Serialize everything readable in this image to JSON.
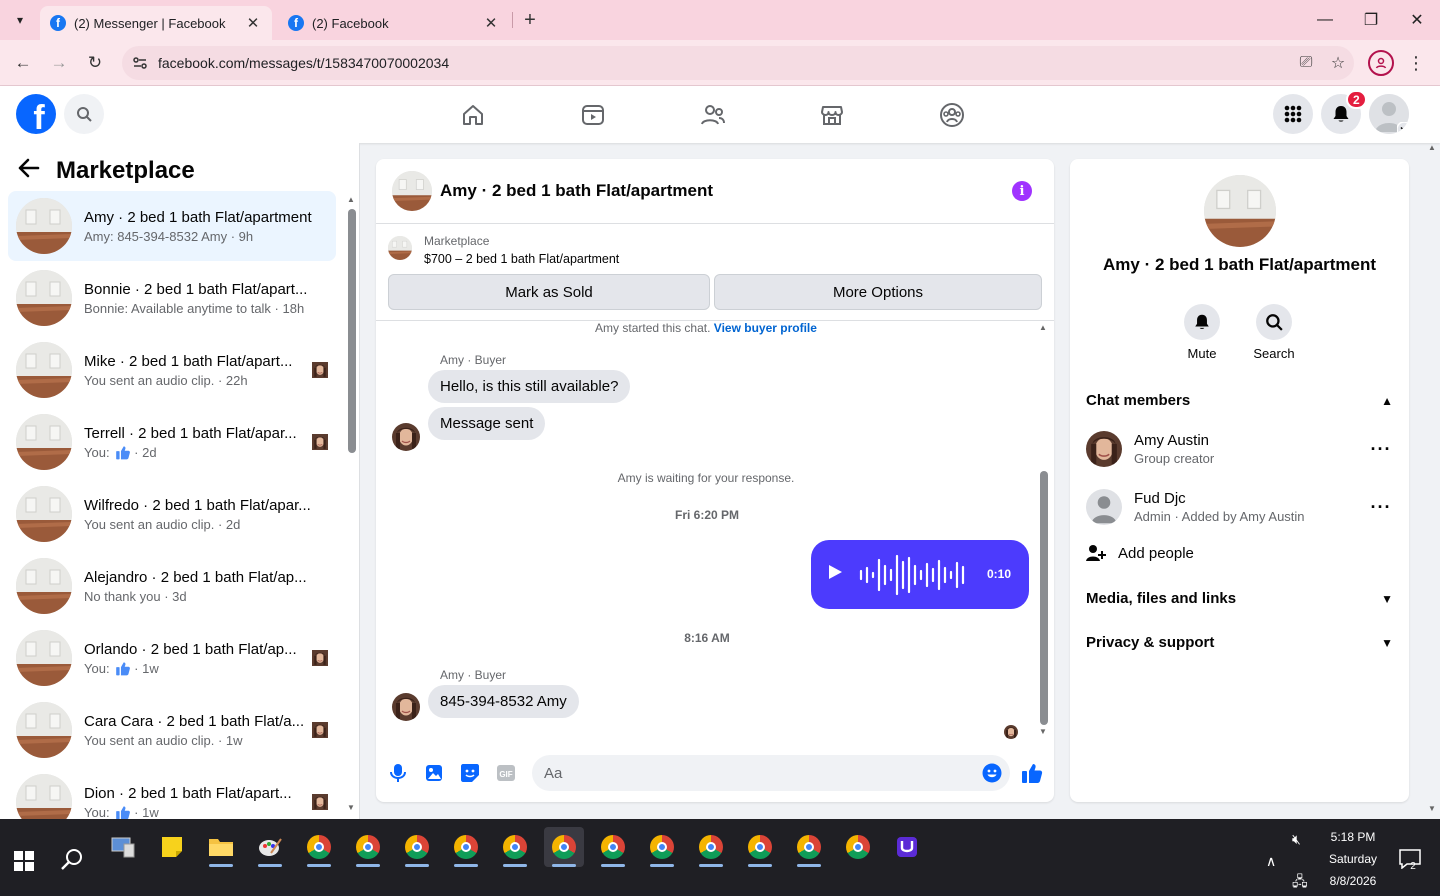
{
  "browser": {
    "tabs": [
      {
        "title": "(2) Messenger | Facebook",
        "active": true
      },
      {
        "title": "(2) Facebook",
        "active": false
      }
    ],
    "url": "facebook.com/messages/t/1583470070002034"
  },
  "header": {
    "notification_count": "2"
  },
  "left": {
    "title": "Marketplace",
    "conversations": [
      {
        "name": "Amy · 2 bed 1 bath Flat/apartment",
        "preview": "Amy: 845-394-8532 Amy",
        "time": "9h",
        "like": false,
        "mini": false,
        "selected": true
      },
      {
        "name": "Bonnie · 2 bed 1 bath Flat/apart...",
        "preview": "Bonnie: Available anytime to talk",
        "time": "18h",
        "like": false,
        "mini": false,
        "selected": false
      },
      {
        "name": "Mike · 2 bed 1 bath Flat/apart...",
        "preview": "You sent an audio clip.",
        "time": "22h",
        "like": false,
        "mini": true,
        "selected": false
      },
      {
        "name": "Terrell · 2 bed 1 bath Flat/apar...",
        "preview": "You:",
        "time": "2d",
        "like": true,
        "mini": true,
        "selected": false
      },
      {
        "name": "Wilfredo · 2 bed 1 bath Flat/apar...",
        "preview": "You sent an audio clip.",
        "time": "2d",
        "like": false,
        "mini": false,
        "selected": false
      },
      {
        "name": "Alejandro · 2 bed 1 bath Flat/ap...",
        "preview": "No thank you",
        "time": "3d",
        "like": false,
        "mini": false,
        "selected": false
      },
      {
        "name": "Orlando · 2 bed 1 bath Flat/ap...",
        "preview": "You:",
        "time": "1w",
        "like": true,
        "mini": true,
        "selected": false
      },
      {
        "name": "Cara Cara · 2 bed 1 bath Flat/a...",
        "preview": "You sent an audio clip.",
        "time": "1w",
        "like": false,
        "mini": true,
        "selected": false
      },
      {
        "name": "Dion · 2 bed 1 bath Flat/apart...",
        "preview": "You:",
        "time": "1w",
        "like": true,
        "mini": true,
        "selected": false
      }
    ]
  },
  "chat": {
    "title": "Amy · 2 bed 1 bath Flat/apartment",
    "marketplace_label": "Marketplace",
    "listing": "$700 – 2 bed 1 bath Flat/apartment",
    "mark_sold": "Mark as Sold",
    "more_options": "More Options",
    "started_text": "Amy started this chat.",
    "buyer_profile_link": "View buyer profile",
    "sender_label": "Amy · Buyer",
    "msg1": "Hello, is this still available?",
    "msg2": "Message sent",
    "waiting": "Amy is waiting for your response.",
    "time1": "Fri 6:20 PM",
    "audio_duration": "0:10",
    "time2": "8:16 AM",
    "sender_label2": "Amy · Buyer",
    "msg3": "845-394-8532 Amy",
    "composer_placeholder": "Aa"
  },
  "details": {
    "title": "Amy · 2 bed 1 bath Flat/apartment",
    "mute": "Mute",
    "search": "Search",
    "chat_members": "Chat members",
    "members": [
      {
        "name": "Amy Austin",
        "role": "Group creator"
      },
      {
        "name": "Fud Djc",
        "role": "Admin · Added by Amy Austin"
      }
    ],
    "add_people": "Add people",
    "media": "Media, files and links",
    "privacy": "Privacy & support"
  },
  "taskbar": {
    "time": "5:18 PM",
    "day": "Saturday",
    "date": "8/8/2026",
    "notifications": "2"
  },
  "colors": {
    "fb_blue": "#0866ff",
    "audio_bubble": "#4c3bfd",
    "tab_bar": "#f9d4df"
  }
}
